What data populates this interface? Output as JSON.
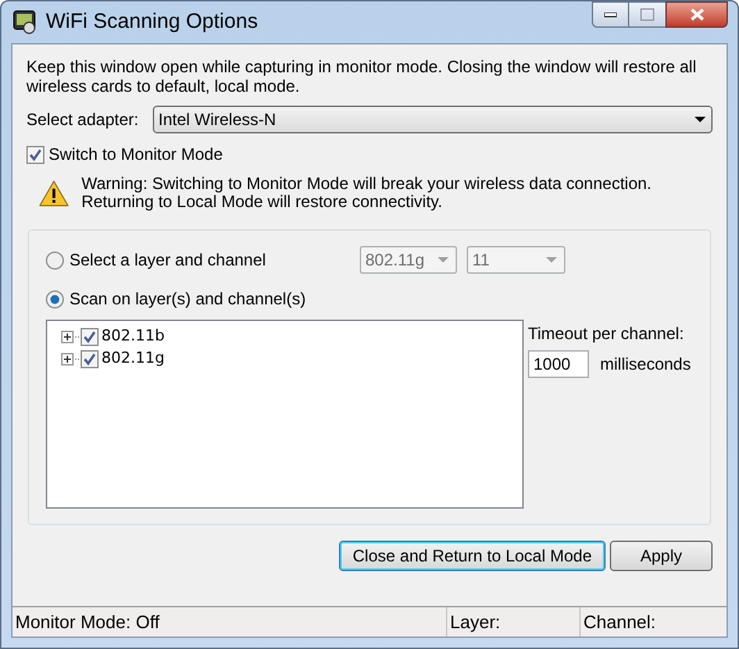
{
  "window": {
    "title": "WiFi Scanning Options"
  },
  "intro": "Keep this window open while capturing in monitor mode. Closing the window will restore all wireless cards to default, local mode.",
  "adapter": {
    "label": "Select adapter:",
    "value": "Intel Wireless-N"
  },
  "monitor_mode": {
    "label": "Switch to Monitor Mode",
    "checked": true
  },
  "warning": "Warning: Switching to Monitor Mode will break your wireless data connection. Returning to Local Mode will restore connectivity.",
  "modes": [
    {
      "label": "Select a layer and channel",
      "selected": false
    },
    {
      "label": "Scan on layer(s) and channel(s)",
      "selected": true
    }
  ],
  "layer_combo": {
    "value": "802.11g",
    "disabled": true
  },
  "channel_combo": {
    "value": "11",
    "disabled": true
  },
  "layers": [
    {
      "label": "802.11b",
      "checked": true,
      "expanded": false
    },
    {
      "label": "802.11g",
      "checked": true,
      "expanded": false
    }
  ],
  "timeout": {
    "label": "Timeout per channel:",
    "value": "1000",
    "unit": "milliseconds"
  },
  "buttons": [
    {
      "label": "Close and Return to Local Mode",
      "default": true
    },
    {
      "label": "Apply",
      "default": false
    }
  ],
  "status_bar": [
    "Monitor Mode: Off",
    "Layer:",
    "Channel:"
  ]
}
